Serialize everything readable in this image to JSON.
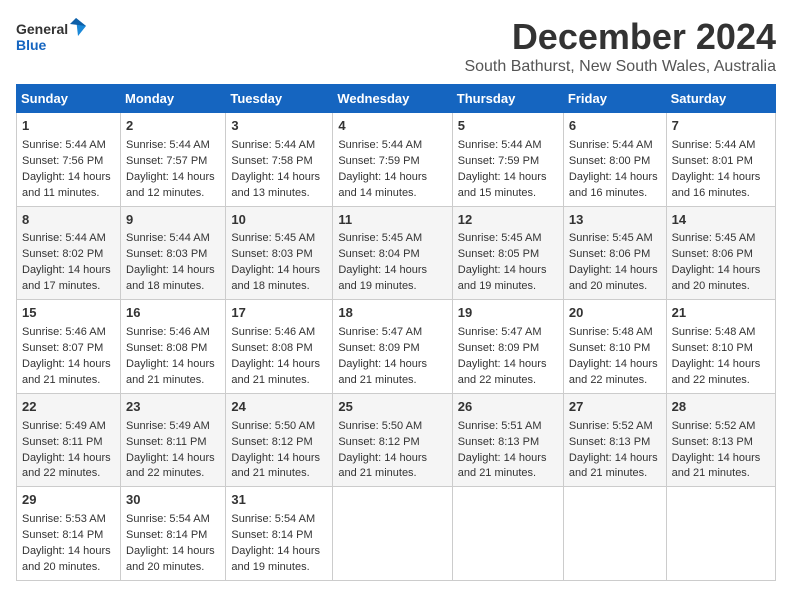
{
  "logo": {
    "line1": "General",
    "line2": "Blue"
  },
  "title": "December 2024",
  "subtitle": "South Bathurst, New South Wales, Australia",
  "days_of_week": [
    "Sunday",
    "Monday",
    "Tuesday",
    "Wednesday",
    "Thursday",
    "Friday",
    "Saturday"
  ],
  "weeks": [
    [
      {
        "day": 1,
        "sunrise": "5:44 AM",
        "sunset": "7:56 PM",
        "daylight": "14 hours and 11 minutes."
      },
      {
        "day": 2,
        "sunrise": "5:44 AM",
        "sunset": "7:57 PM",
        "daylight": "14 hours and 12 minutes."
      },
      {
        "day": 3,
        "sunrise": "5:44 AM",
        "sunset": "7:58 PM",
        "daylight": "14 hours and 13 minutes."
      },
      {
        "day": 4,
        "sunrise": "5:44 AM",
        "sunset": "7:59 PM",
        "daylight": "14 hours and 14 minutes."
      },
      {
        "day": 5,
        "sunrise": "5:44 AM",
        "sunset": "7:59 PM",
        "daylight": "14 hours and 15 minutes."
      },
      {
        "day": 6,
        "sunrise": "5:44 AM",
        "sunset": "8:00 PM",
        "daylight": "14 hours and 16 minutes."
      },
      {
        "day": 7,
        "sunrise": "5:44 AM",
        "sunset": "8:01 PM",
        "daylight": "14 hours and 16 minutes."
      }
    ],
    [
      {
        "day": 8,
        "sunrise": "5:44 AM",
        "sunset": "8:02 PM",
        "daylight": "14 hours and 17 minutes."
      },
      {
        "day": 9,
        "sunrise": "5:44 AM",
        "sunset": "8:03 PM",
        "daylight": "14 hours and 18 minutes."
      },
      {
        "day": 10,
        "sunrise": "5:45 AM",
        "sunset": "8:03 PM",
        "daylight": "14 hours and 18 minutes."
      },
      {
        "day": 11,
        "sunrise": "5:45 AM",
        "sunset": "8:04 PM",
        "daylight": "14 hours and 19 minutes."
      },
      {
        "day": 12,
        "sunrise": "5:45 AM",
        "sunset": "8:05 PM",
        "daylight": "14 hours and 19 minutes."
      },
      {
        "day": 13,
        "sunrise": "5:45 AM",
        "sunset": "8:06 PM",
        "daylight": "14 hours and 20 minutes."
      },
      {
        "day": 14,
        "sunrise": "5:45 AM",
        "sunset": "8:06 PM",
        "daylight": "14 hours and 20 minutes."
      }
    ],
    [
      {
        "day": 15,
        "sunrise": "5:46 AM",
        "sunset": "8:07 PM",
        "daylight": "14 hours and 21 minutes."
      },
      {
        "day": 16,
        "sunrise": "5:46 AM",
        "sunset": "8:08 PM",
        "daylight": "14 hours and 21 minutes."
      },
      {
        "day": 17,
        "sunrise": "5:46 AM",
        "sunset": "8:08 PM",
        "daylight": "14 hours and 21 minutes."
      },
      {
        "day": 18,
        "sunrise": "5:47 AM",
        "sunset": "8:09 PM",
        "daylight": "14 hours and 21 minutes."
      },
      {
        "day": 19,
        "sunrise": "5:47 AM",
        "sunset": "8:09 PM",
        "daylight": "14 hours and 22 minutes."
      },
      {
        "day": 20,
        "sunrise": "5:48 AM",
        "sunset": "8:10 PM",
        "daylight": "14 hours and 22 minutes."
      },
      {
        "day": 21,
        "sunrise": "5:48 AM",
        "sunset": "8:10 PM",
        "daylight": "14 hours and 22 minutes."
      }
    ],
    [
      {
        "day": 22,
        "sunrise": "5:49 AM",
        "sunset": "8:11 PM",
        "daylight": "14 hours and 22 minutes."
      },
      {
        "day": 23,
        "sunrise": "5:49 AM",
        "sunset": "8:11 PM",
        "daylight": "14 hours and 22 minutes."
      },
      {
        "day": 24,
        "sunrise": "5:50 AM",
        "sunset": "8:12 PM",
        "daylight": "14 hours and 21 minutes."
      },
      {
        "day": 25,
        "sunrise": "5:50 AM",
        "sunset": "8:12 PM",
        "daylight": "14 hours and 21 minutes."
      },
      {
        "day": 26,
        "sunrise": "5:51 AM",
        "sunset": "8:13 PM",
        "daylight": "14 hours and 21 minutes."
      },
      {
        "day": 27,
        "sunrise": "5:52 AM",
        "sunset": "8:13 PM",
        "daylight": "14 hours and 21 minutes."
      },
      {
        "day": 28,
        "sunrise": "5:52 AM",
        "sunset": "8:13 PM",
        "daylight": "14 hours and 21 minutes."
      }
    ],
    [
      {
        "day": 29,
        "sunrise": "5:53 AM",
        "sunset": "8:14 PM",
        "daylight": "14 hours and 20 minutes."
      },
      {
        "day": 30,
        "sunrise": "5:54 AM",
        "sunset": "8:14 PM",
        "daylight": "14 hours and 20 minutes."
      },
      {
        "day": 31,
        "sunrise": "5:54 AM",
        "sunset": "8:14 PM",
        "daylight": "14 hours and 19 minutes."
      },
      null,
      null,
      null,
      null
    ]
  ]
}
